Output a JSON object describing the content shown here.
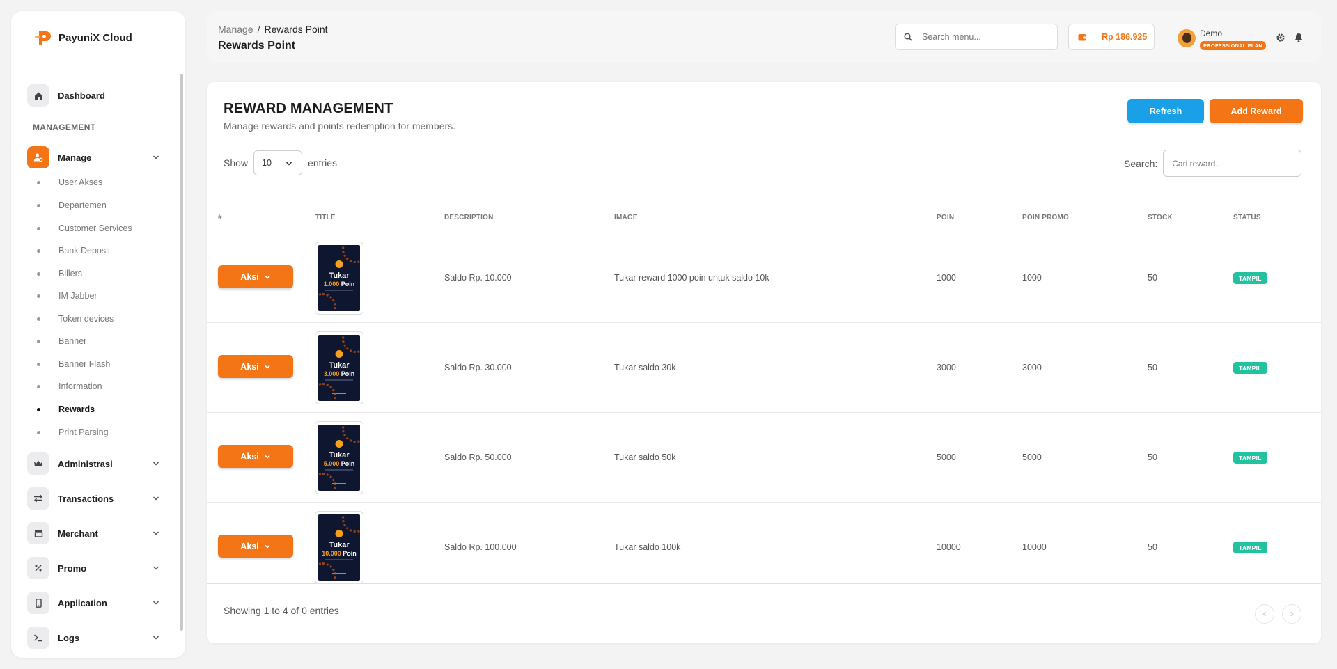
{
  "brand": {
    "name": "PayuniX Cloud"
  },
  "sidebar": {
    "dashboard": "Dashboard",
    "section_management": "MANAGEMENT",
    "manage": "Manage",
    "manage_items": [
      "User Akses",
      "Departemen",
      "Customer Services",
      "Bank Deposit",
      "Billers",
      "IM Jabber",
      "Token devices",
      "Banner",
      "Banner Flash",
      "Information",
      "Rewards",
      "Print Parsing"
    ],
    "active_item": "Rewards",
    "groups": [
      "Administrasi",
      "Transactions",
      "Merchant",
      "Promo",
      "Application",
      "Logs"
    ]
  },
  "header": {
    "breadcrumb_root": "Manage",
    "breadcrumb_sep": "/",
    "breadcrumb_current": "Rewards Point",
    "title": "Rewards Point",
    "search_placeholder": "Search menu...",
    "balance": "Rp 186.925",
    "user_name": "Demo",
    "plan": "PROFESSIONAL PLAN"
  },
  "card": {
    "title": "REWARD MANAGEMENT",
    "subtitle": "Manage rewards and points redemption for members.",
    "refresh_label": "Refresh",
    "add_label": "Add Reward",
    "show_label": "Show",
    "entries_label": "entries",
    "page_length": "10",
    "search_label": "Search:",
    "search_placeholder": "Cari reward...",
    "info": "Showing 1 to 4 of 0 entries"
  },
  "table": {
    "columns": [
      "#",
      "TITLE",
      "DESCRIPTION",
      "IMAGE",
      "POIN",
      "POIN PROMO",
      "STOCK",
      "STATUS"
    ],
    "action_label": "Aksi",
    "rows": [
      {
        "poster_title": "Tukar",
        "poster_points": "1.000",
        "poster_unit": "Poin",
        "title": "Saldo Rp. 10.000",
        "description": "Tukar reward 1000 poin untuk saldo 10k",
        "poin": "1000",
        "poin_promo": "1000",
        "stock": "50",
        "status": "TAMPIL"
      },
      {
        "poster_title": "Tukar",
        "poster_points": "3.000",
        "poster_unit": "Poin",
        "title": "Saldo Rp. 30.000",
        "description": "Tukar saldo 30k",
        "poin": "3000",
        "poin_promo": "3000",
        "stock": "50",
        "status": "TAMPIL"
      },
      {
        "poster_title": "Tukar",
        "poster_points": "5.000",
        "poster_unit": "Poin",
        "title": "Saldo Rp. 50.000",
        "description": "Tukar saldo 50k",
        "poin": "5000",
        "poin_promo": "5000",
        "stock": "50",
        "status": "TAMPIL"
      },
      {
        "poster_title": "Tukar",
        "poster_points": "10.000",
        "poster_unit": "Poin",
        "title": "Saldo Rp. 100.000",
        "description": "Tukar saldo 100k",
        "poin": "10000",
        "poin_promo": "10000",
        "stock": "50",
        "status": "TAMPIL"
      }
    ]
  },
  "colors": {
    "accent": "#f47516",
    "refresh": "#1aa0e6",
    "status": "#22c2a0"
  }
}
